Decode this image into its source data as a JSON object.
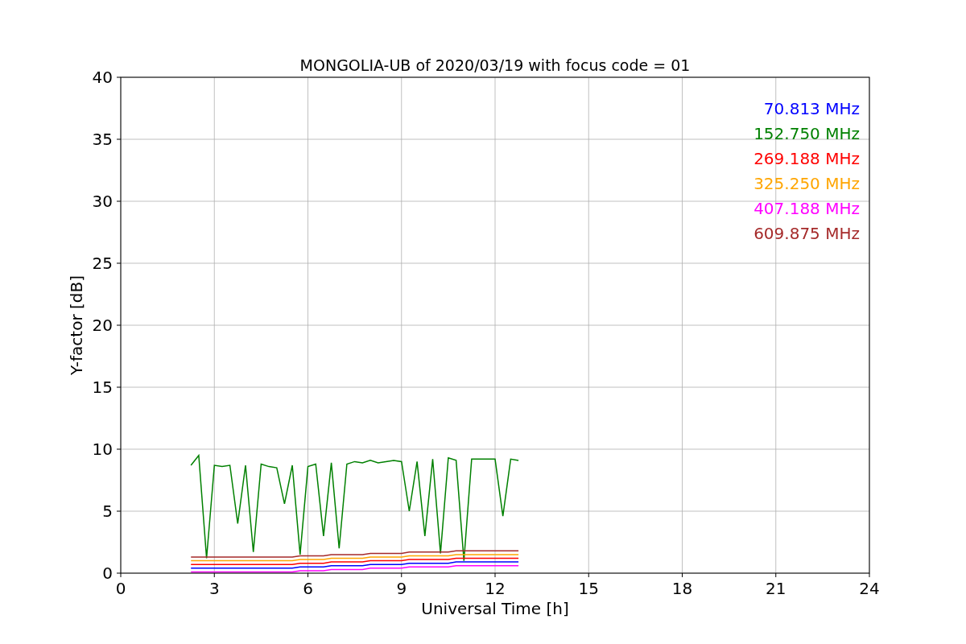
{
  "figure": {
    "chart_data": {
      "type": "line",
      "title": "MONGOLIA-UB of 2020/03/19 with focus code = 01",
      "xlabel": "Universal Time [h]",
      "ylabel": "Y-factor [dB]",
      "x": [
        2.25,
        2.5,
        2.75,
        3,
        3.25,
        3.5,
        3.75,
        4,
        4.25,
        4.5,
        4.75,
        5,
        5.25,
        5.5,
        5.75,
        6,
        6.25,
        6.5,
        6.75,
        7,
        7.25,
        7.5,
        7.75,
        8,
        8.25,
        8.5,
        8.75,
        9,
        9.25,
        9.5,
        9.75,
        10,
        10.25,
        10.5,
        10.75,
        11,
        11.25,
        11.5,
        11.75,
        12,
        12.25,
        12.5,
        12.75
      ],
      "series": [
        {
          "name": "70.813 MHz",
          "color": "#0000ff",
          "values": [
            0.4,
            0.4,
            0.4,
            0.4,
            0.4,
            0.4,
            0.4,
            0.4,
            0.4,
            0.4,
            0.4,
            0.4,
            0.4,
            0.4,
            0.5,
            0.5,
            0.5,
            0.5,
            0.6,
            0.6,
            0.6,
            0.6,
            0.6,
            0.7,
            0.7,
            0.7,
            0.7,
            0.7,
            0.8,
            0.8,
            0.8,
            0.8,
            0.8,
            0.8,
            0.9,
            0.9,
            0.9,
            0.9,
            0.9,
            0.9,
            0.9,
            0.9,
            0.9
          ]
        },
        {
          "name": "152.750 MHz",
          "color": "#008000",
          "values": [
            8.7,
            9.5,
            1.2,
            8.7,
            8.6,
            8.7,
            4.0,
            8.7,
            1.7,
            8.8,
            8.6,
            8.5,
            5.6,
            8.7,
            1.5,
            8.6,
            8.8,
            3.0,
            8.9,
            2.0,
            8.8,
            9.0,
            8.9,
            9.1,
            8.9,
            9.0,
            9.1,
            9.0,
            5.0,
            9.0,
            3.0,
            9.2,
            1.6,
            9.3,
            9.1,
            1.0,
            9.2,
            9.2,
            9.2,
            9.2,
            4.6,
            9.2,
            9.1
          ]
        },
        {
          "name": "269.188 MHz",
          "color": "#ff0000",
          "values": [
            0.7,
            0.7,
            0.7,
            0.7,
            0.7,
            0.7,
            0.7,
            0.7,
            0.7,
            0.7,
            0.7,
            0.7,
            0.7,
            0.7,
            0.8,
            0.8,
            0.8,
            0.8,
            0.9,
            0.9,
            0.9,
            0.9,
            0.9,
            1.0,
            1.0,
            1.0,
            1.0,
            1.0,
            1.1,
            1.1,
            1.1,
            1.1,
            1.1,
            1.1,
            1.2,
            1.2,
            1.2,
            1.2,
            1.2,
            1.2,
            1.2,
            1.2,
            1.2
          ]
        },
        {
          "name": "325.250 MHz",
          "color": "#ffa500",
          "values": [
            1.0,
            1.0,
            1.0,
            1.0,
            1.0,
            1.0,
            1.0,
            1.0,
            1.0,
            1.0,
            1.0,
            1.0,
            1.0,
            1.0,
            1.1,
            1.1,
            1.1,
            1.1,
            1.2,
            1.2,
            1.2,
            1.2,
            1.2,
            1.3,
            1.3,
            1.3,
            1.3,
            1.3,
            1.4,
            1.4,
            1.4,
            1.4,
            1.4,
            1.4,
            1.5,
            1.5,
            1.5,
            1.5,
            1.5,
            1.5,
            1.5,
            1.5,
            1.5
          ]
        },
        {
          "name": "407.188 MHz",
          "color": "#ff00ff",
          "values": [
            0.1,
            0.1,
            0.1,
            0.1,
            0.1,
            0.1,
            0.1,
            0.1,
            0.1,
            0.1,
            0.1,
            0.1,
            0.1,
            0.1,
            0.2,
            0.2,
            0.2,
            0.2,
            0.3,
            0.3,
            0.3,
            0.3,
            0.3,
            0.4,
            0.4,
            0.4,
            0.4,
            0.4,
            0.5,
            0.5,
            0.5,
            0.5,
            0.5,
            0.5,
            0.6,
            0.6,
            0.6,
            0.6,
            0.6,
            0.6,
            0.6,
            0.6,
            0.6
          ]
        },
        {
          "name": "609.875 MHz",
          "color": "#a52a2a",
          "values": [
            1.3,
            1.3,
            1.3,
            1.3,
            1.3,
            1.3,
            1.3,
            1.3,
            1.3,
            1.3,
            1.3,
            1.3,
            1.3,
            1.3,
            1.4,
            1.4,
            1.4,
            1.4,
            1.5,
            1.5,
            1.5,
            1.5,
            1.5,
            1.6,
            1.6,
            1.6,
            1.6,
            1.6,
            1.7,
            1.7,
            1.7,
            1.7,
            1.7,
            1.7,
            1.8,
            1.8,
            1.8,
            1.8,
            1.8,
            1.8,
            1.8,
            1.8,
            1.8
          ]
        }
      ],
      "grid": true,
      "xlim": [
        0,
        24
      ],
      "ylim": [
        0,
        40
      ],
      "xticks": [
        0,
        3,
        6,
        9,
        12,
        15,
        18,
        21,
        24
      ],
      "yticks": [
        0,
        5,
        10,
        15,
        20,
        25,
        30,
        35,
        40
      ]
    }
  }
}
